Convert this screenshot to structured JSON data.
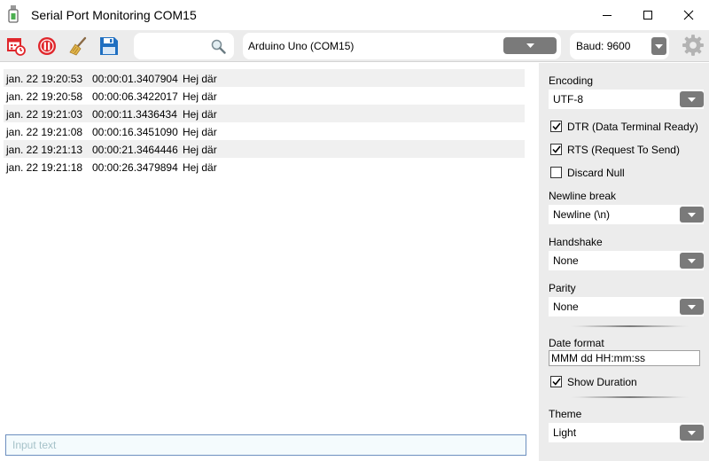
{
  "window": {
    "title": "Serial Port Monitoring COM15"
  },
  "toolbar": {
    "search": {
      "placeholder": "",
      "value": ""
    },
    "port": {
      "selected": "Arduino Uno (COM15)"
    },
    "baud": {
      "label": "Baud: 9600"
    },
    "icons": [
      "schedule-icon",
      "pause-icon",
      "broom-clear-icon",
      "save-icon",
      "search-icon",
      "gear-icon"
    ]
  },
  "log": {
    "rows": [
      {
        "date": "jan. 22 19:20:53",
        "duration": "00:00:01.3407904",
        "message": "Hej där"
      },
      {
        "date": "jan. 22 19:20:58",
        "duration": "00:00:06.3422017",
        "message": "Hej där"
      },
      {
        "date": "jan. 22 19:21:03",
        "duration": "00:00:11.3436434",
        "message": "Hej där"
      },
      {
        "date": "jan. 22 19:21:08",
        "duration": "00:00:16.3451090",
        "message": "Hej där"
      },
      {
        "date": "jan. 22 19:21:13",
        "duration": "00:00:21.3464446",
        "message": "Hej där"
      },
      {
        "date": "jan. 22 19:21:18",
        "duration": "00:00:26.3479894",
        "message": "Hej där"
      }
    ],
    "input_placeholder": "Input text"
  },
  "settings": {
    "encoding": {
      "label": "Encoding",
      "value": "UTF-8"
    },
    "dtr": {
      "label": "DTR (Data Terminal Ready)",
      "checked": true
    },
    "rts": {
      "label": "RTS (Request To Send)",
      "checked": true
    },
    "discard_null": {
      "label": "Discard Null",
      "checked": false
    },
    "newline": {
      "label": "Newline break",
      "value": "Newline (\\n)"
    },
    "handshake": {
      "label": "Handshake",
      "value": "None"
    },
    "parity": {
      "label": "Parity",
      "value": "None"
    },
    "date_format": {
      "label": "Date format",
      "value": "MMM dd HH:mm:ss"
    },
    "show_duration": {
      "label": "Show Duration",
      "checked": true
    },
    "theme": {
      "label": "Theme",
      "value": "Light"
    }
  },
  "colors": {
    "accent_red": "#e0262b",
    "save_blue": "#1f6fc1",
    "dropdown_gray": "#7a7a7a",
    "panel_bg": "#ececec"
  }
}
